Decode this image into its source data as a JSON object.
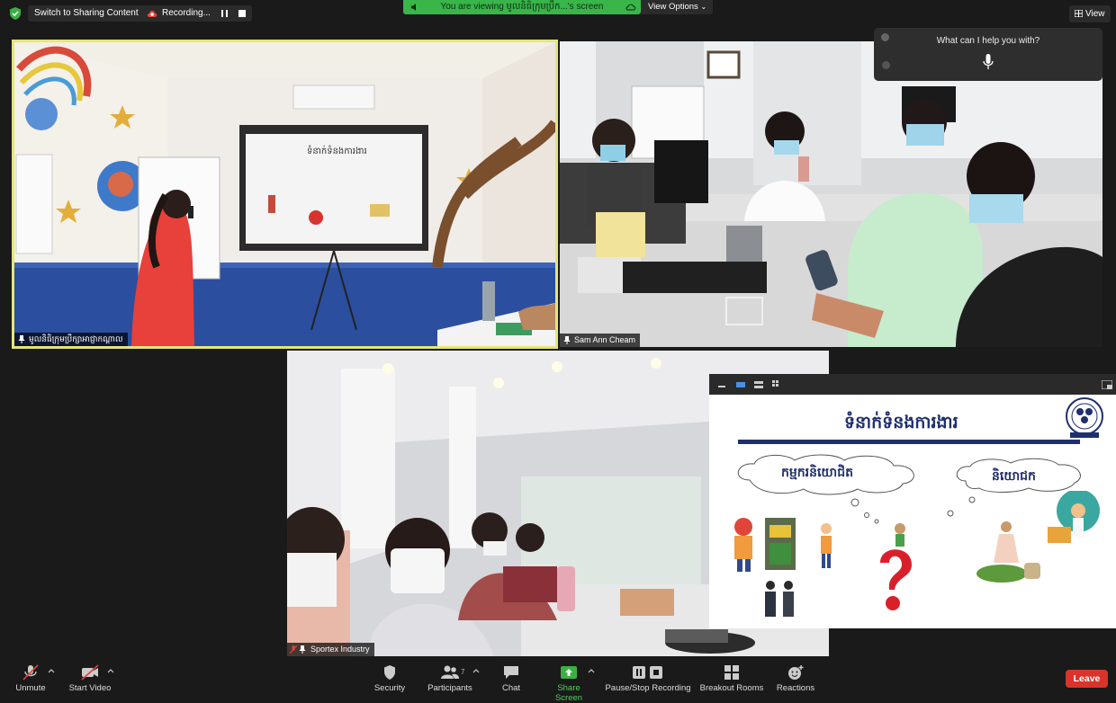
{
  "top": {
    "switch_label": "Switch to Sharing Content",
    "recording_label": "Recording...",
    "viewing_banner": "You are viewing មូលនិធិក្រុមប្រឹក...'s screen",
    "view_options": "View Options",
    "view_label": "View"
  },
  "assistant": {
    "prompt": "What can I help you with?"
  },
  "tiles": [
    {
      "name": "មូលនិធិក្រុមប្រឹក្សាអាជ្ញាកណ្ដាល"
    },
    {
      "name": "Sam Ann Cheam"
    },
    {
      "name": "Sportex Industry"
    }
  ],
  "slide": {
    "title": "ទំនាក់ទំនងការងារ",
    "left_cloud": "កម្មករនិយោជិត",
    "right_cloud": "និយោជក",
    "logo_text": "ACF FOUNDATION"
  },
  "toolbar": {
    "unmute": "Unmute",
    "start_video": "Start Video",
    "security": "Security",
    "participants": "Participants",
    "participants_count": "7",
    "chat": "Chat",
    "share_screen": "Share Screen",
    "pause_stop": "Pause/Stop Recording",
    "breakout": "Breakout Rooms",
    "reactions": "Reactions",
    "leave": "Leave"
  },
  "colors": {
    "accent_green": "#39b54a",
    "leave_red": "#d9342b",
    "active_border": "#e5e57a",
    "slide_navy": "#1f2f6e"
  }
}
